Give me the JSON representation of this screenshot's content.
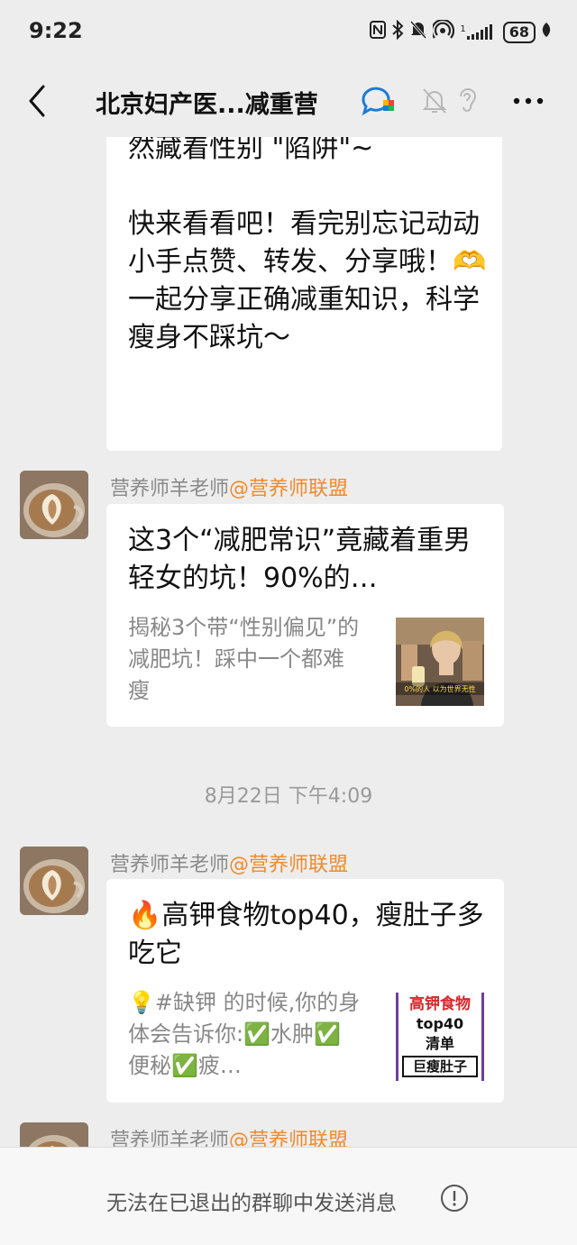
{
  "status_bar": {
    "time": "9:22",
    "signal_sup": "1",
    "battery": "68"
  },
  "nav": {
    "title": "北京妇产医...减重营"
  },
  "messages": {
    "first": {
      "text": "然藏着性别 \"陷阱\"~\n\n快来看看吧！看完别忘记动动小手点赞、转发、分享哦！🫶一起分享正确减重知识，科学瘦身不踩坑～"
    },
    "second": {
      "sender_name": "营养师羊老师",
      "sender_org": "@营养师联盟",
      "title": "这3个“减肥常识”竟藏着重男轻女的坑！90%的…",
      "desc": "揭秘3个带“性别偏见”的减肥坑！踩中一个都难瘦",
      "thumb_caption": "0%的人 以为世界无性"
    },
    "timestamp": "8月22日 下午4:09",
    "third": {
      "sender_name": "营养师羊老师",
      "sender_org": "@营养师联盟",
      "title": "🔥高钾食物top40，瘦肚子多吃它",
      "desc": "💡#缺钾 的时候,你的身体会告诉你:✅水肿✅便秘✅疲…",
      "thumb": {
        "line1": "高钾食物",
        "line2": "top40",
        "line3": "清单",
        "line4": "巨瘦肚子"
      }
    },
    "fourth": {
      "sender_name": "营养师羊老师",
      "sender_org": "@营养师联盟"
    }
  },
  "bottom": {
    "notice": "无法在已退出的群聊中发送消息"
  },
  "colors": {
    "background": "#ededed",
    "org_accent": "#f08a2c",
    "thumb_red": "#d9262b",
    "thumb_purple": "#6b3fa0"
  },
  "icons": [
    "back-arrow-icon",
    "enterprise-badge-icon",
    "mute-bell-icon",
    "ear-icon",
    "more-icon",
    "info-icon",
    "nfc-icon",
    "bluetooth-icon",
    "dnd-icon",
    "hotspot-icon",
    "signal-icon",
    "leaf-icon"
  ]
}
